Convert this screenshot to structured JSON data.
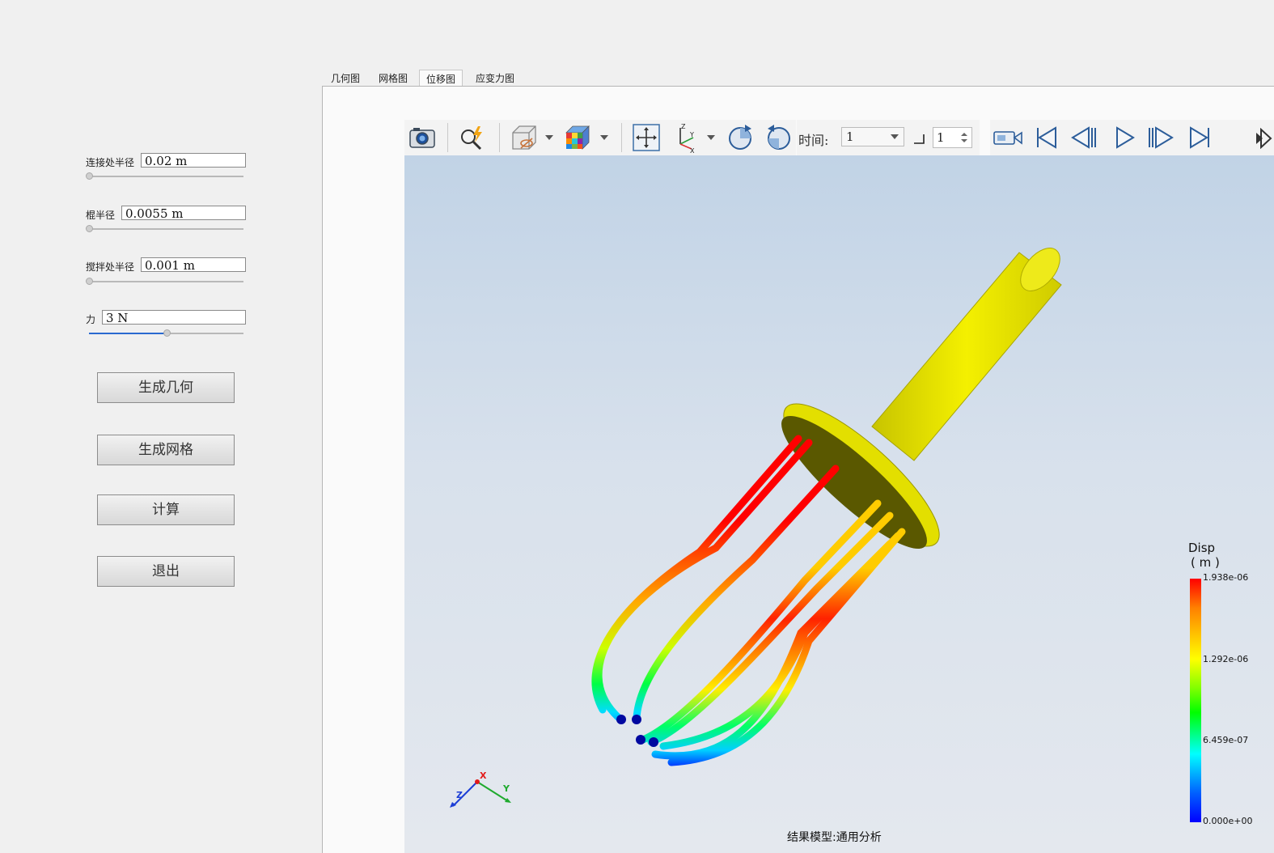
{
  "left_panel": {
    "params": [
      {
        "label": "连接处半径",
        "value": "0.02 m",
        "slider": 0.0
      },
      {
        "label": "棍半径",
        "value": "0.0055 m",
        "slider": 0.0
      },
      {
        "label": "搅拌处半径",
        "value": "0.001 m",
        "slider": 0.0
      },
      {
        "label": "力",
        "value": "3 N",
        "slider": 0.5
      }
    ],
    "buttons": {
      "gen_geometry": "生成几何",
      "gen_mesh": "生成网格",
      "compute": "计算",
      "exit": "退出"
    }
  },
  "tabs": [
    {
      "label": "几何图",
      "active": false
    },
    {
      "label": "网格图",
      "active": false
    },
    {
      "label": "位移图",
      "active": true
    },
    {
      "label": "应变力图",
      "active": false
    }
  ],
  "toolbar": {
    "time_label": "时间:",
    "time_value": "1",
    "step_value": "1",
    "icons": [
      "camera-icon",
      "zoom-icon",
      "display-mode-icon",
      "color-cube-icon",
      "fit-view-icon",
      "axes-icon",
      "rotate-cw-icon",
      "rotate-ccw-icon",
      "record-icon",
      "first-frame-icon",
      "prev-frame-icon",
      "play-icon",
      "next-frame-icon",
      "last-frame-icon"
    ]
  },
  "legend": {
    "title": "Disp",
    "unit": "( m )",
    "max": "1.938e-06",
    "v2": "1.292e-06",
    "v1": "6.459e-07",
    "min": "0.000e+00",
    "colors": [
      "#ff0000",
      "#ffff00",
      "#00ff00",
      "#00ffff",
      "#0000ff"
    ]
  },
  "triad": {
    "x": "X",
    "y": "Y",
    "z": "Z"
  },
  "caption": "结果模型:通用分析"
}
